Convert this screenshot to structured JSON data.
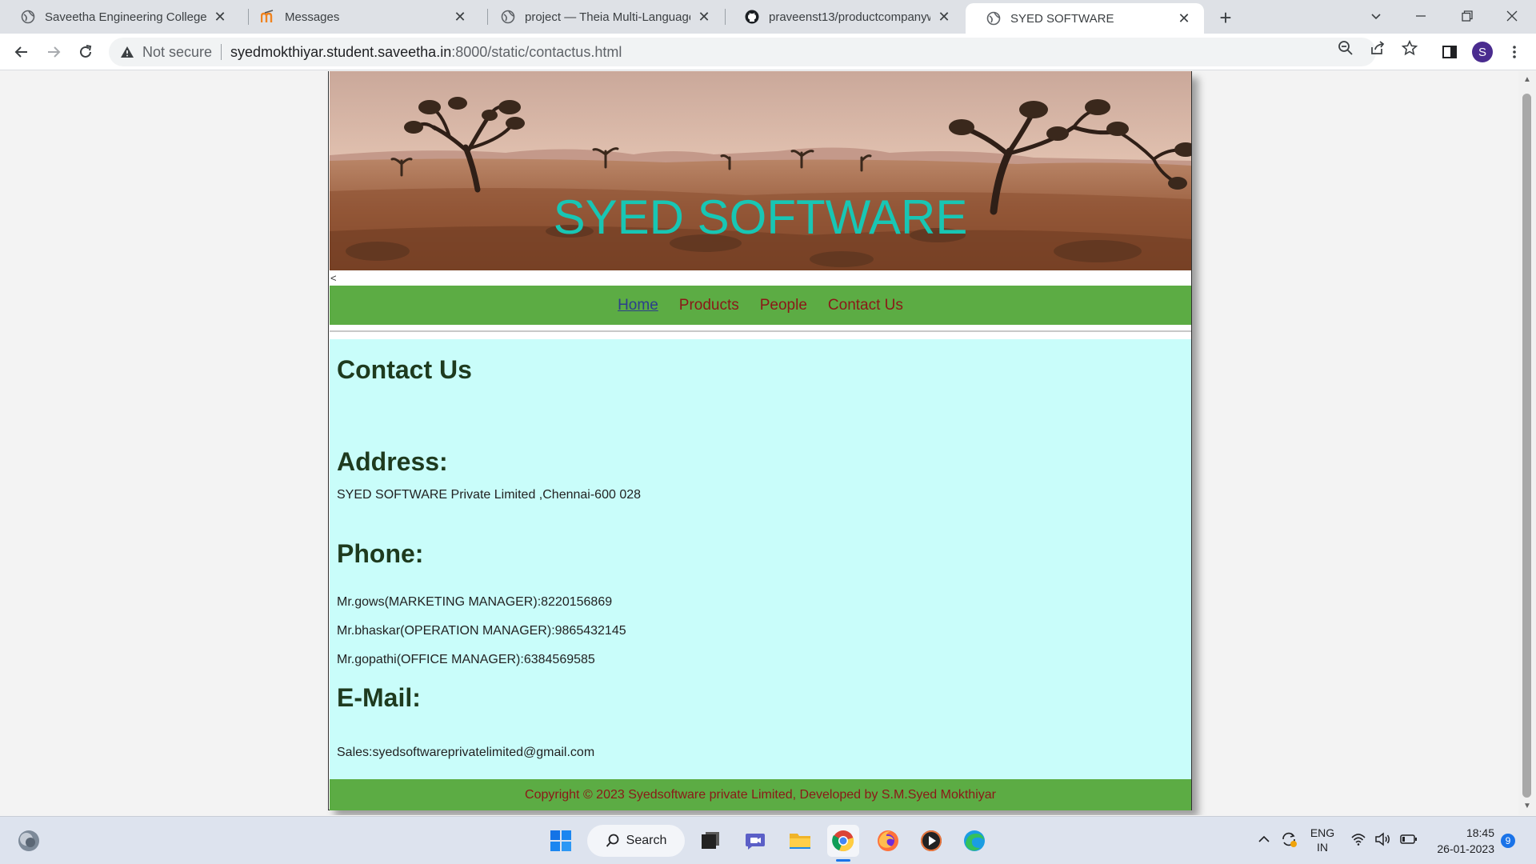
{
  "browser": {
    "tabs": [
      {
        "title": "Saveetha Engineering College",
        "icon": "globe-icon"
      },
      {
        "title": "Messages",
        "icon": "moodle-icon"
      },
      {
        "title": "project — Theia Multi-Language",
        "icon": "globe-icon"
      },
      {
        "title": "praveenst13/productcompanywe",
        "icon": "github-icon"
      },
      {
        "title": "SYED SOFTWARE",
        "icon": "globe-icon"
      }
    ],
    "active_tab_index": 4,
    "security_label": "Not secure",
    "url_host": "syedmokthiyar.student.saveetha.in",
    "url_path": ":8000/static/contactus.html",
    "profile_initial": "S"
  },
  "page": {
    "banner_title": "SYED SOFTWARE",
    "stray_text": "<",
    "nav": {
      "home": "Home",
      "products": "Products",
      "people": "People",
      "contact": "Contact Us"
    },
    "heading": "Contact Us",
    "address": {
      "label": "Address:",
      "text": "SYED SOFTWARE Private Limited ,Chennai-600 028"
    },
    "phone": {
      "label": "Phone:",
      "lines": [
        "Mr.gows(MARKETING MANAGER):8220156869",
        "Mr.bhaskar(OPERATION MANAGER):9865432145",
        "Mr.gopathi(OFFICE MANAGER):6384569585"
      ]
    },
    "email": {
      "label": "E-Mail:",
      "text": "Sales:syedsoftwareprivatelimited@gmail.com"
    },
    "footer": "Copyright © 2023 Syedsoftware private Limited, Developed by S.M.Syed Mokthiyar"
  },
  "taskbar": {
    "search_label": "Search",
    "language": "ENG",
    "region": "IN",
    "time": "18:45",
    "date": "26-01-2023",
    "notification_count": "9"
  },
  "colors": {
    "nav_green": "#5cac44",
    "banner_title": "#18c6b4",
    "content_bg": "#c9fdfa",
    "link_red": "#8b1818"
  }
}
